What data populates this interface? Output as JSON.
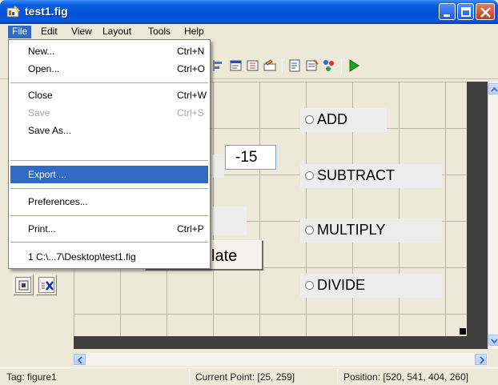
{
  "window": {
    "title": "test1.fig"
  },
  "menubar": {
    "items": [
      "File",
      "Edit",
      "View",
      "Layout",
      "Tools",
      "Help"
    ],
    "active": "File"
  },
  "file_menu": {
    "items": [
      {
        "label": "New...",
        "shortcut": "Ctrl+N",
        "enabled": true
      },
      {
        "label": "Open...",
        "shortcut": "Ctrl+O",
        "enabled": true
      },
      {
        "label": "Close",
        "shortcut": "Ctrl+W",
        "enabled": true
      },
      {
        "label": "Save",
        "shortcut": "Ctrl+S",
        "enabled": false
      },
      {
        "label": "Save As...",
        "shortcut": "",
        "enabled": true
      },
      {
        "label": "Export ...",
        "shortcut": "",
        "enabled": true,
        "highlighted": true
      },
      {
        "label": "Preferences...",
        "shortcut": "",
        "enabled": true
      },
      {
        "label": "Print...",
        "shortcut": "Ctrl+P",
        "enabled": true
      },
      {
        "label": "1 C:\\...7\\Desktop\\test1.fig",
        "shortcut": "",
        "enabled": true
      }
    ]
  },
  "toolbar": {
    "icons": [
      "align-objects-icon",
      "menu-editor-icon",
      "tab-order-icon",
      "toolbar-editor-icon",
      "mfile-editor-icon",
      "property-inspector-icon",
      "object-browser-icon",
      "run-icon"
    ]
  },
  "palette": {
    "buttons": [
      "toggle-button-tool-icon",
      "activex-tool-icon"
    ]
  },
  "canvas": {
    "edit_value": "-15",
    "button_label": "late",
    "radios": [
      "ADD",
      "SUBTRACT",
      "MULTIPLY",
      "DIVIDE"
    ]
  },
  "status": {
    "tag": "Tag: figure1",
    "current_point": "Current Point:  [25, 259]",
    "position": "Position: [520, 541, 404, 260]"
  },
  "colors": {
    "titlebar": "#0050d8",
    "menu_highlight": "#316ac5",
    "canvas_bg": "#ece9d8",
    "run_green": "#1fa01f"
  }
}
